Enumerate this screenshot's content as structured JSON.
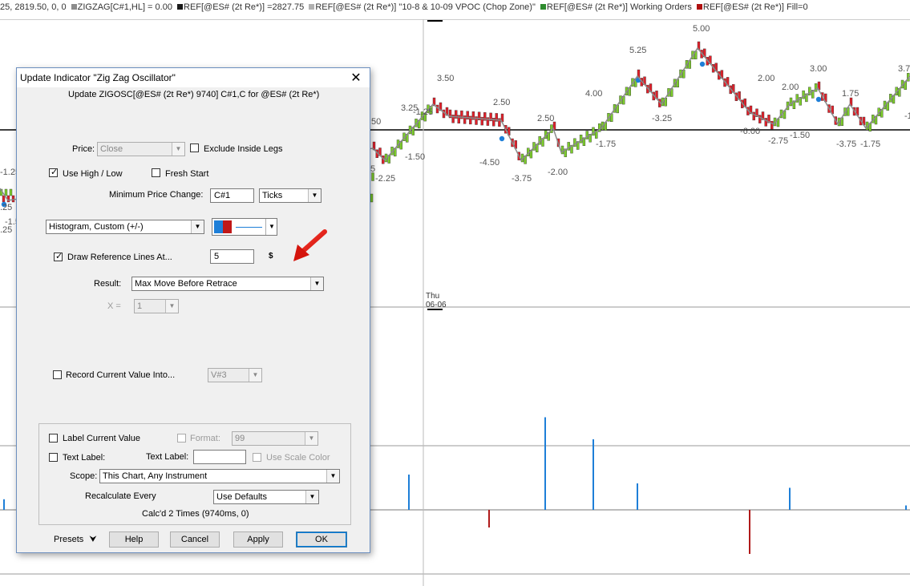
{
  "chart": {
    "status_segments": [
      {
        "text": "25, 2819.50, 0, 0 ",
        "color": null
      },
      {
        "text": "ZIGZAG[C#1,HL] = 0.00 ",
        "color": "#8c8c8c"
      },
      {
        "text": "REF[@ES# (2t Re*)] =2827.75 ",
        "color": "#1a1a1a"
      },
      {
        "text": "REF[@ES# (2t Re*)] \"10-8 & 10-09 VPOC (Chop Zone)\" ",
        "color": "#b0b0b0"
      },
      {
        "text": "REF[@ES# (2t Re*)] Working Orders ",
        "color": "#2e8b2e"
      },
      {
        "text": "REF[@ES# (2t Re*)] Fill=0",
        "color": "#b01010"
      }
    ],
    "date_label_day": "Thu",
    "date_label_date": "06-06",
    "swing_labels": [
      "-1.25",
      ".25",
      "-1.5",
      ".25",
      "3.50",
      "3.25",
      "-1.25",
      ".50",
      "5",
      "-1.50",
      "-2.25",
      "2.50",
      "-4.50",
      "-3.75",
      "2.50",
      "-2.00",
      "4.00",
      "-1.75",
      "5.25",
      "-3.25",
      "5.00",
      "2.00",
      "-6.00",
      "2.00",
      "-2.75",
      "-1.50",
      "3.00",
      "1.75",
      "-3.75",
      "-1.75",
      "3.7",
      "-1"
    ],
    "osc_bars": [
      {
        "value": 0.6,
        "sign": "pos"
      },
      {
        "value": 2.0,
        "sign": "pos"
      },
      {
        "value": -1.0,
        "sign": "neg"
      },
      {
        "value": 5.25,
        "sign": "pos"
      },
      {
        "value": 4.0,
        "sign": "pos"
      },
      {
        "value": 1.5,
        "sign": "pos"
      },
      {
        "value": -2.5,
        "sign": "neg"
      },
      {
        "value": 1.25,
        "sign": "pos"
      },
      {
        "value": 0.25,
        "sign": "pos"
      }
    ],
    "colors": {
      "up": "#7ccd2a",
      "down": "#e0202a",
      "pos_bar": "#1e7fd8",
      "neg_bar": "#b01b1b",
      "zigzag": "#8a8a8a",
      "dot": "#1e7fd8"
    }
  },
  "dialog": {
    "title": "Update Indicator \"Zig Zag Oscillator\"",
    "subtitle": "Update ZIGOSC[@ES# (2t Re*) 9740] C#1,C for @ES# (2t Re*)",
    "close_glyph": "✕",
    "price": {
      "label": "Price:",
      "value": "Close"
    },
    "exclude_inside_legs": {
      "label": "Exclude Inside Legs",
      "checked": false
    },
    "use_high_low": {
      "label": "Use High / Low",
      "checked": true
    },
    "fresh_start": {
      "label": "Fresh Start",
      "checked": false
    },
    "min_price_change": {
      "label": "Minimum Price Change:",
      "value": "C#1",
      "unit": "Ticks"
    },
    "style": {
      "value": "Histogram, Custom (+/-)",
      "color1": "#1e7fd8",
      "color2": "#c01818"
    },
    "draw_ref_lines": {
      "label": "Draw Reference Lines At...",
      "checked": true,
      "value": "5",
      "suffix": "$"
    },
    "result": {
      "label": "Result:",
      "value": "Max Move Before Retrace"
    },
    "x": {
      "label": "X =",
      "value": "1"
    },
    "record_value": {
      "label": "Record Current Value Into...",
      "checked": false,
      "value": "V#3"
    },
    "label_current_value": {
      "label": "Label Current Value",
      "checked": false
    },
    "format": {
      "label": "Format:",
      "value": "99"
    },
    "text_label_cb": {
      "label": "Text Label:",
      "checked": false
    },
    "text_label_field": {
      "label": "Text Label:",
      "value": ""
    },
    "use_scale_color": {
      "label": "Use Scale Color"
    },
    "scope": {
      "label": "Scope:",
      "value": "This Chart, Any Instrument"
    },
    "recalc": {
      "label": "Recalculate Every",
      "value": "Use Defaults"
    },
    "calcd": "Calc'd 2 Times (9740ms, 0)",
    "buttons": {
      "presets": "Presets",
      "help": "Help",
      "cancel": "Cancel",
      "apply": "Apply",
      "ok": "OK"
    },
    "check_glyph": "✓",
    "arrow_glyph": "▼",
    "chevron_glyph": "⮟"
  }
}
